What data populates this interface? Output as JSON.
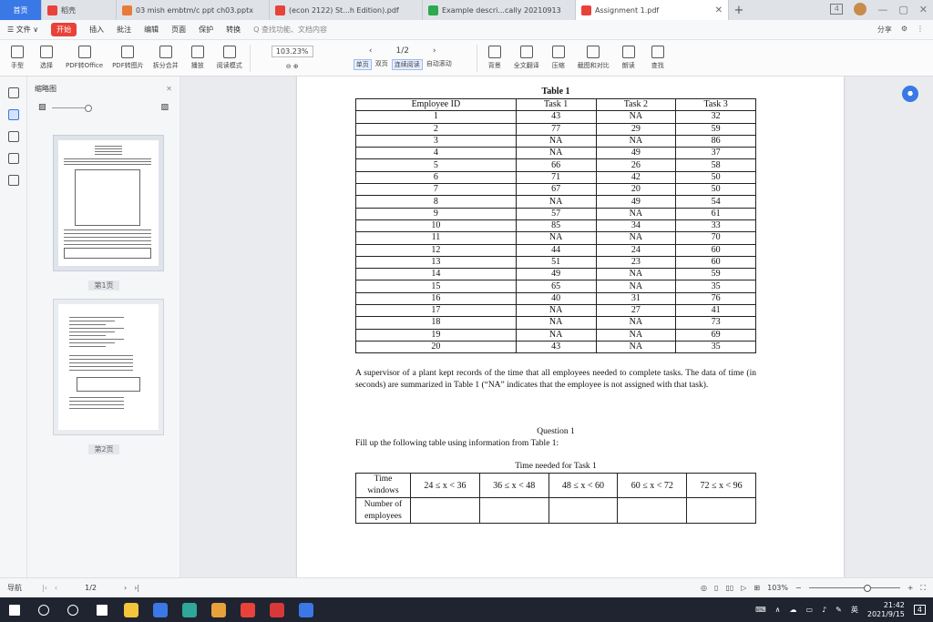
{
  "tabs": [
    {
      "label": "首页",
      "kind": "home"
    },
    {
      "label": "稻壳",
      "icon_color": "#e8423a"
    },
    {
      "label": "03 mish embtm/c ppt ch03.pptx",
      "icon_color": "#e87b3a"
    },
    {
      "label": "(econ 2122)  St...h Edition).pdf",
      "icon_color": "#e8423a"
    },
    {
      "label": "Example  descri...cally  20210913",
      "icon_color": "#2fa84f"
    },
    {
      "label": "Assignment 1.pdf",
      "icon_color": "#e8423a",
      "active": true
    }
  ],
  "window": {
    "counter": "4",
    "controls": [
      "—",
      "▢",
      "✕"
    ]
  },
  "menu": {
    "items": [
      "☰ 文件 ∨",
      "插入",
      "批注",
      "编辑",
      "页面",
      "保护",
      "转换"
    ],
    "start": "开始",
    "search": "Q 查找功能、文档内容",
    "right_items": [
      "分享",
      "⚙",
      "⋮"
    ]
  },
  "ribbon": {
    "tools": [
      {
        "icon": "hand-icon",
        "label": "手型"
      },
      {
        "icon": "cursor-icon",
        "label": "选择"
      },
      {
        "icon": "pdf-office-icon",
        "label": "PDF转Office"
      },
      {
        "icon": "pdf-image-icon",
        "label": "PDF转图片"
      },
      {
        "icon": "split-icon",
        "label": "拆分合并"
      },
      {
        "icon": "play-icon",
        "label": "播放"
      },
      {
        "icon": "read-mode-icon",
        "label": "阅读模式"
      }
    ],
    "zoom": "103.23%",
    "page": "1/2",
    "view_tools": [
      {
        "label": "单页",
        "active": true
      },
      {
        "label": "双页"
      },
      {
        "label": "连续阅读",
        "active": true
      },
      {
        "label": "自动滚动"
      }
    ],
    "right_tools": [
      {
        "icon": "background-icon",
        "label": "背景"
      },
      {
        "icon": "translate-icon",
        "label": "全文翻译"
      },
      {
        "icon": "compress-icon",
        "label": "压缩"
      },
      {
        "icon": "screenshot-icon",
        "label": "截图和对比"
      },
      {
        "icon": "read-aloud-icon",
        "label": "朗读"
      },
      {
        "icon": "find-icon",
        "label": "查找"
      }
    ]
  },
  "thumbnails": {
    "title": "缩略图",
    "page1_label": "第1页",
    "page2_label": "第2页"
  },
  "document": {
    "table1_caption": "Table 1",
    "table1_headers": [
      "Employee ID",
      "Task 1",
      "Task 2",
      "Task 3"
    ],
    "table1_rows": [
      [
        "1",
        "43",
        "NA",
        "32"
      ],
      [
        "2",
        "77",
        "29",
        "59"
      ],
      [
        "3",
        "NA",
        "NA",
        "86"
      ],
      [
        "4",
        "NA",
        "49",
        "37"
      ],
      [
        "5",
        "66",
        "26",
        "58"
      ],
      [
        "6",
        "71",
        "42",
        "50"
      ],
      [
        "7",
        "67",
        "20",
        "50"
      ],
      [
        "8",
        "NA",
        "49",
        "54"
      ],
      [
        "9",
        "57",
        "NA",
        "61"
      ],
      [
        "10",
        "85",
        "34",
        "33"
      ],
      [
        "11",
        "NA",
        "NA",
        "70"
      ],
      [
        "12",
        "44",
        "24",
        "60"
      ],
      [
        "13",
        "51",
        "23",
        "60"
      ],
      [
        "14",
        "49",
        "NA",
        "59"
      ],
      [
        "15",
        "65",
        "NA",
        "35"
      ],
      [
        "16",
        "40",
        "31",
        "76"
      ],
      [
        "17",
        "NA",
        "27",
        "41"
      ],
      [
        "18",
        "NA",
        "NA",
        "73"
      ],
      [
        "19",
        "NA",
        "NA",
        "69"
      ],
      [
        "20",
        "43",
        "NA",
        "35"
      ]
    ],
    "paragraph": "A supervisor of a plant kept records of the time that all employees needed to complete tasks. The data of time (in seconds) are summarized in Table 1 (“NA” indicates that the employee is not assigned with that task).",
    "question_title": "Question 1",
    "question_text": "Fill up the following table using information from Table 1:",
    "table2_caption": "Time needed for Task 1",
    "table2_row1_header": "Time windows",
    "table2_row2_header": "Number of employees",
    "table2_windows": [
      "24 ≤ x < 36",
      "36 ≤ x < 48",
      "48 ≤ x < 60",
      "60 ≤ x < 72",
      "72 ≤ x < 96"
    ]
  },
  "statusbar": {
    "nav_label": "导航",
    "page": "1/2",
    "zoom": "103%"
  },
  "taskbar": {
    "apps": [
      {
        "icon": "windows-icon",
        "color": "#ffffff"
      },
      {
        "icon": "search-icon",
        "color": "#ffffff"
      },
      {
        "icon": "cortana-icon",
        "color": "#ffffff"
      },
      {
        "icon": "task-view-icon",
        "color": "#ffffff"
      },
      {
        "icon": "file-explorer-icon",
        "color": "#f2c53d"
      },
      {
        "icon": "mail-icon",
        "color": "#3a78e6"
      },
      {
        "icon": "edge-icon",
        "color": "#2fa89a"
      },
      {
        "icon": "chrome-icon",
        "color": "#e8a23a"
      },
      {
        "icon": "wps-doc-icon",
        "color": "#e8423a"
      },
      {
        "icon": "wps-writer-icon",
        "color": "#d93838"
      },
      {
        "icon": "zoom-icon",
        "color": "#3a78e6"
      }
    ],
    "ime": "英",
    "time": "21:42",
    "date": "2021/9/15",
    "notifications": "4"
  }
}
